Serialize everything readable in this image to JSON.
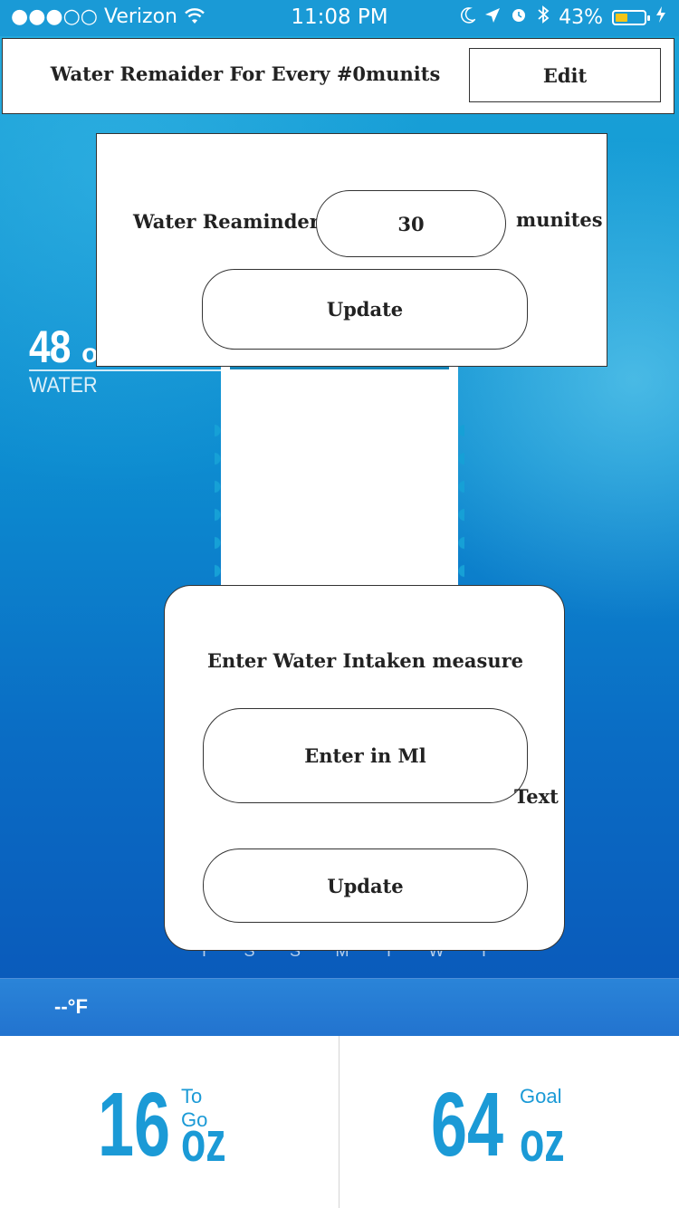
{
  "status_bar": {
    "signal": "●●●○○",
    "carrier": "Verizon",
    "time": "11:08 PM",
    "battery": "43%",
    "battery_level": 0.43
  },
  "header": {
    "title": "Water Remaider For Every #0munits",
    "edit_label": "Edit"
  },
  "reminder": {
    "label": "Water Reaminder",
    "value": "30",
    "unit": "munites",
    "update_label": "Update"
  },
  "intake_display": {
    "amount": "48",
    "unit": "oz",
    "label": "WATER"
  },
  "week_days": [
    "T",
    "S",
    "S",
    "M",
    "T",
    "W",
    "T"
  ],
  "intake_dialog": {
    "title": "Enter Water  Intaken measure",
    "placeholder": "Enter in Ml",
    "text_label": "Text",
    "update_label": "Update"
  },
  "weather": {
    "temp": "--°F"
  },
  "stats": {
    "to_go": {
      "value": "16",
      "caption": "To Go",
      "unit": "oz"
    },
    "goal": {
      "value": "64",
      "caption": "Goal",
      "unit": "oz"
    }
  },
  "colors": {
    "accent": "#1b9ad6",
    "battery": "#f5c518"
  }
}
